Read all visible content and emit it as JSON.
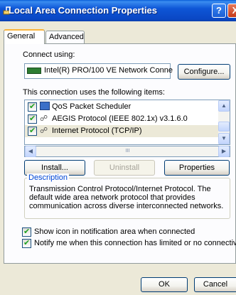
{
  "window": {
    "title": "Local Area Connection Properties"
  },
  "titlebar": {
    "help_glyph": "?",
    "close_glyph": "X"
  },
  "tabs": [
    "General",
    "Advanced"
  ],
  "connect": {
    "label": "Connect using:",
    "adapter": "Intel(R) PRO/100 VE Network Conne",
    "configure_label": "Configure..."
  },
  "items_label": "This connection uses the following items:",
  "items": [
    {
      "label": "QoS Packet Scheduler",
      "checked": true
    },
    {
      "label": "AEGIS Protocol (IEEE 802.1x) v3.1.6.0",
      "checked": true
    },
    {
      "label": "Internet Protocol (TCP/IP)",
      "checked": true,
      "selected": true
    }
  ],
  "scroll_glyph": "III",
  "buttons": {
    "install": "Install...",
    "uninstall": "Uninstall",
    "properties": "Properties"
  },
  "description": {
    "legend": "Description",
    "text": "Transmission Control Protocol/Internet Protocol. The default wide area network protocol that provides communication across diverse interconnected networks."
  },
  "options": [
    {
      "label": "Show icon in notification area when connected",
      "checked": true
    },
    {
      "label": "Notify me when this connection has limited or no connectivity",
      "checked": true
    }
  ],
  "footer": {
    "ok": "OK",
    "cancel": "Cancel"
  }
}
